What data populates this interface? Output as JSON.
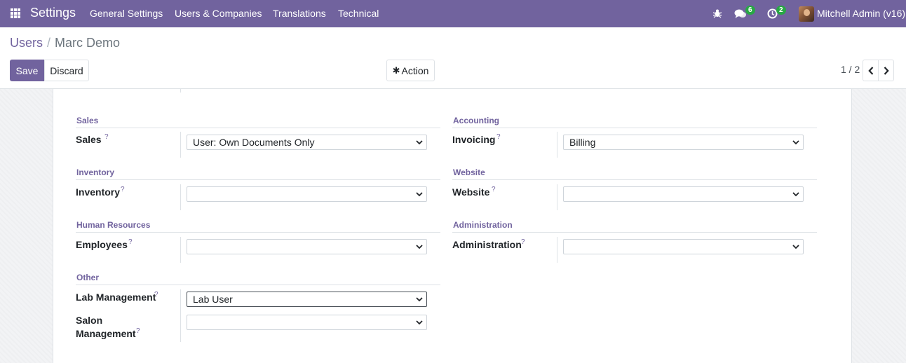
{
  "navbar": {
    "app_title": "Settings",
    "menu": [
      "General Settings",
      "Users & Companies",
      "Translations",
      "Technical"
    ],
    "messages_count": "6",
    "activities_count": "2",
    "user_name": "Mitchell Admin (v16)",
    "bg_color": "#71639e"
  },
  "breadcrumb": {
    "parent": "Users",
    "separator": "/",
    "current": "Marc Demo"
  },
  "buttons": {
    "save": "Save",
    "discard": "Discard",
    "action": "Action"
  },
  "pager": {
    "value": "1 / 2"
  },
  "sections": {
    "sales": {
      "title": "Sales",
      "field_label": "Sales",
      "value": "User: Own Documents Only"
    },
    "accounting": {
      "title": "Accounting",
      "field_label": "Invoicing",
      "value": "Billing"
    },
    "inventory": {
      "title": "Inventory",
      "field_label": "Inventory",
      "value": ""
    },
    "website": {
      "title": "Website",
      "field_label": "Website",
      "value": ""
    },
    "hr": {
      "title": "Human Resources",
      "field_label": "Employees",
      "value": ""
    },
    "administration": {
      "title": "Administration",
      "field_label": "Administration",
      "value": ""
    },
    "other": {
      "title": "Other",
      "lab_label": "Lab Management",
      "lab_value": "Lab User",
      "salon_label_line1": "Salon",
      "salon_label_line2": "Management",
      "salon_value": ""
    }
  },
  "help_mark": "?",
  "icons": {
    "apps": "apps-grid-icon",
    "bug": "bug-icon",
    "messages": "chat-icon",
    "activities": "clock-icon",
    "action": "gear-icon",
    "prev": "chevron-left-icon",
    "next": "chevron-right-icon",
    "select": "chevron-down-icon"
  }
}
